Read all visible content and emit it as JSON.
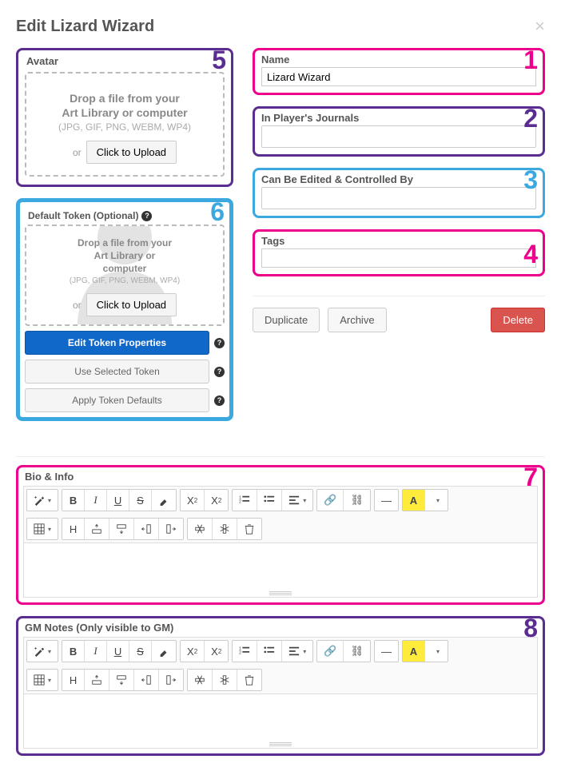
{
  "header": {
    "title": "Edit Lizard Wizard",
    "close": "×"
  },
  "annotations": {
    "n1": "1",
    "n2": "2",
    "n3": "3",
    "n4": "4",
    "n5": "5",
    "n6": "6",
    "n7": "7",
    "n8": "8"
  },
  "avatar": {
    "label": "Avatar",
    "drop_title_l1": "Drop a file from your",
    "drop_title_l2": "Art Library or computer",
    "formats": "(JPG, GIF, PNG, WEBM, WP4)",
    "or": "or",
    "upload_btn": "Click to Upload"
  },
  "token": {
    "label": "Default Token (Optional)",
    "drop_title_l1": "Drop a file from your",
    "drop_title_l2": "Art Library or",
    "drop_title_l3": "computer",
    "formats": "(JPG, GIF, PNG, WEBM, WP4)",
    "or": "or",
    "upload_btn": "Click to Upload",
    "btn_edit": "Edit Token Properties",
    "btn_use": "Use Selected Token",
    "btn_apply": "Apply Token Defaults"
  },
  "fields": {
    "name_label": "Name",
    "name_value": "Lizard Wizard",
    "journals_label": "In Player's Journals",
    "controlled_label": "Can Be Edited & Controlled By",
    "tags_label": "Tags"
  },
  "actions": {
    "duplicate": "Duplicate",
    "archive": "Archive",
    "delete": "Delete"
  },
  "bio": {
    "label": "Bio & Info"
  },
  "gmnotes": {
    "label": "GM Notes (Only visible to GM)"
  },
  "toolbar": {
    "bold": "B",
    "italic": "I",
    "underline": "U",
    "strike": "S",
    "sup_base": "X",
    "sup_mark": "2",
    "sub_base": "X",
    "sub_mark": "2",
    "link": "🔗",
    "unlink": "⛓",
    "hr": "—",
    "hilite": "A",
    "h": "H",
    "minus": "−"
  }
}
